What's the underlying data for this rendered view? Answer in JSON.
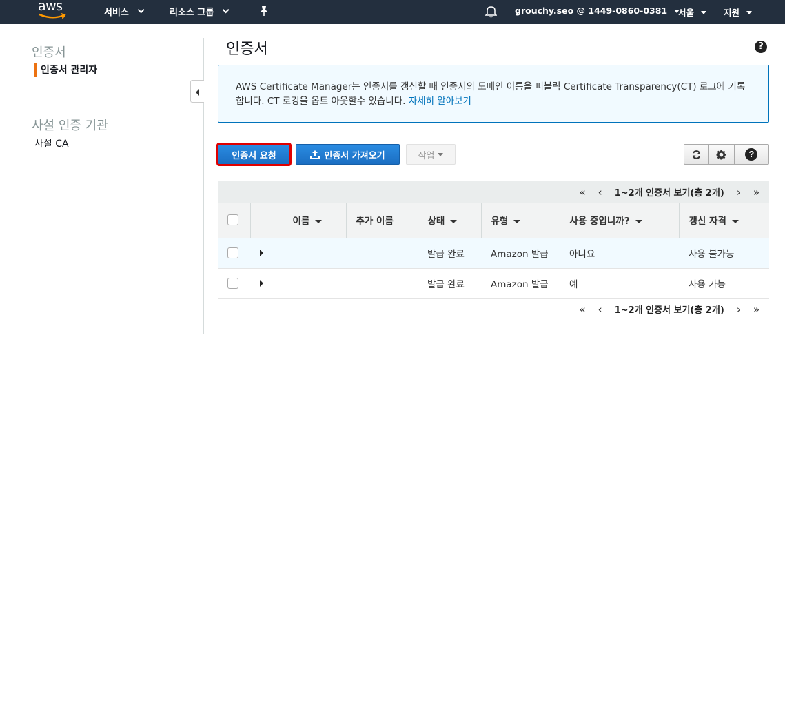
{
  "topnav": {
    "logo_text": "aws",
    "services": "서비스",
    "resource_groups": "리소스 그룹",
    "account": "grouchy.seo @ 1449-0860-0381",
    "region": "서울",
    "support": "지원"
  },
  "sidebar": {
    "heading_certificates": "인증서",
    "item_cert_manager": "인증서 관리자",
    "heading_private_ca": "사설 인증 기관",
    "item_private_ca": "사설 CA"
  },
  "main": {
    "title": "인증서",
    "help_icon_text": "?",
    "info_text": "AWS Certificate Manager는 인증서를 갱신할 때 인증서의 도메인 이름을 퍼블릭 Certificate Transparency(CT) 로그에 기록합니다. CT 로깅을 옵트 아웃할수 있습니다.",
    "info_link": "자세히 알아보기"
  },
  "toolbar": {
    "request_label": "인증서 요청",
    "import_label": "인증서 가져오기",
    "actions_label": "작업"
  },
  "pager": {
    "first": "«",
    "prev": "‹",
    "summary": "1~2개 인증서 보기(총 2개)",
    "next": "›",
    "last": "»"
  },
  "table": {
    "columns": [
      "이름",
      "추가 이름",
      "상태",
      "유형",
      "사용 중입니까?",
      "갱신 자격"
    ],
    "rows": [
      {
        "name": "",
        "additional_names": "",
        "status": "발급 완료",
        "type": "Amazon 발급",
        "in_use": "아니요",
        "renewal": "사용 불가능"
      },
      {
        "name": "",
        "additional_names": "",
        "status": "발급 완료",
        "type": "Amazon 발급",
        "in_use": "예",
        "renewal": "사용 가능"
      }
    ]
  },
  "colors": {
    "nav_bg": "#232f3e",
    "primary_button": "#1b6ec2",
    "highlight_outline": "#e00000",
    "status_green": "#1d8102",
    "info_border": "#0073bb",
    "active_marker": "#ec7211"
  },
  "icons": {
    "bell": "bell-icon",
    "pin": "pin-icon",
    "upload": "upload-icon",
    "refresh": "refresh-icon",
    "settings": "gear-icon",
    "help": "help-icon"
  }
}
